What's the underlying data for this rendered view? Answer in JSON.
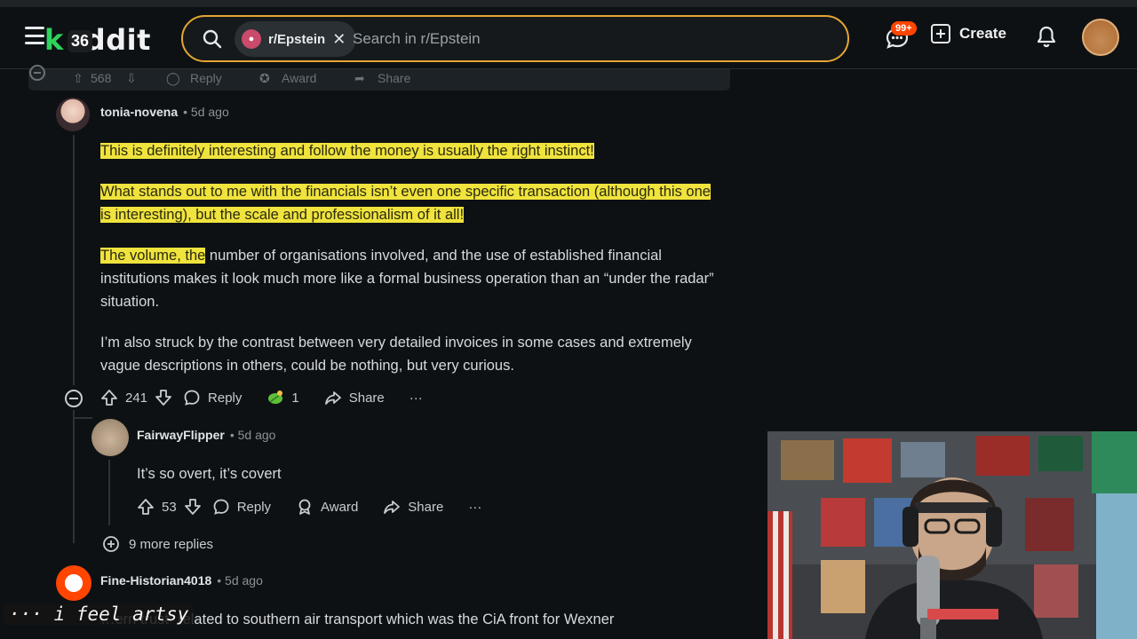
{
  "header": {
    "logo_text": "ddit",
    "logo_k": "k",
    "logo_badge": "36",
    "subreddit_chip": "r/Epstein",
    "search_placeholder": "Search in r/Epstein",
    "notifications_badge": "99+",
    "create_label": "Create"
  },
  "prev_comment_actions": {
    "votes": "568",
    "reply": "Reply",
    "award": "Award",
    "share": "Share"
  },
  "comments": [
    {
      "username": "tonia-novena",
      "age": "• 5d ago",
      "paragraphs": [
        {
          "hl": "This is definitely interesting and follow the money is usually the right instinct!",
          "rest": ""
        },
        {
          "hl": "What stands out to me with the financials isn’t even one specific transaction (although this one is interesting), but the scale and professionalism of it all!",
          "rest": ""
        },
        {
          "hl": "The volume, the",
          "rest": " number of organisations involved, and the use of established financial institutions makes it look much more like a formal business operation than an “under the radar” situation."
        },
        {
          "hl": "",
          "rest": "I’m also struck by the contrast between very detailed invoices in some cases and extremely vague descriptions in others, could be nothing, but very curious."
        }
      ],
      "votes": "241",
      "reply": "Reply",
      "award_count": "1",
      "share": "Share",
      "more": "···"
    },
    {
      "username": "FairwayFlipper",
      "age": "• 5d ago",
      "text": "It’s so overt, it’s covert",
      "votes": "53",
      "reply": "Reply",
      "award": "Award",
      "share": "Share",
      "more": "···"
    },
    {
      "username": "Fine-Historian4018",
      "age": "• 5d ago",
      "text": "…ern trust” related to southern air transport which was the CiA front for Wexner"
    }
  ],
  "more_replies": "9 more replies",
  "overlay_caption": "··· i feel artsy",
  "colors": {
    "highlight": "#f0e33d",
    "search_border": "#e5a632",
    "notif_badge": "#ff4500"
  }
}
